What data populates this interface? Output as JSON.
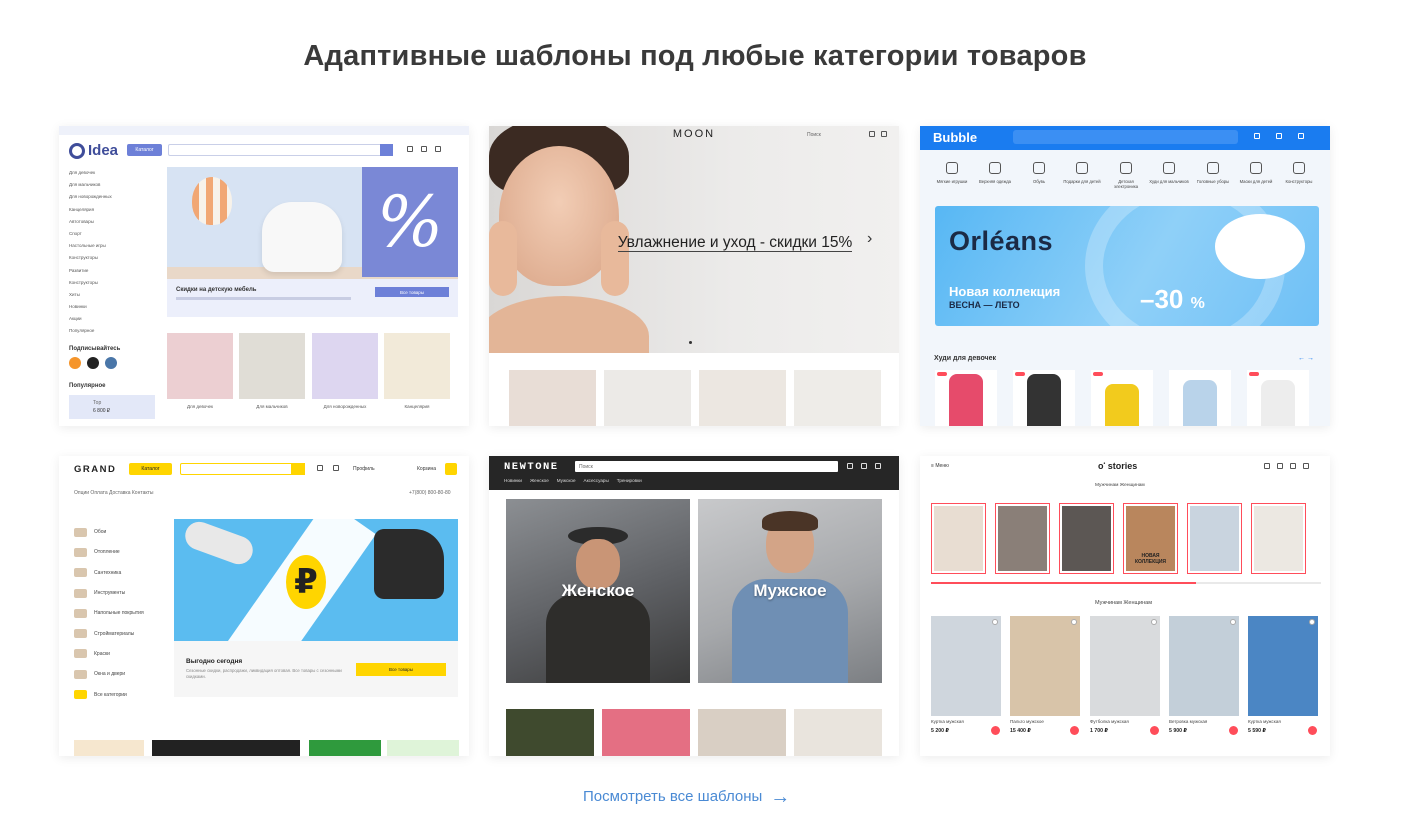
{
  "heading": "Адаптивные шаблоны под любые категории товаров",
  "footer": {
    "view_all": "Посмотреть все шаблоны",
    "arrow_icon": "arrow-right-icon"
  },
  "colors": {
    "link": "#4a8ad4",
    "idea": "#6d80d8",
    "bubble": "#1a7cf0",
    "grand": "#ffd500",
    "stories": "#ff4d5a"
  },
  "templates": {
    "idea": {
      "logo": "Idea",
      "catalog": "Каталог",
      "menu": [
        "Для девочек",
        "Для мальчиков",
        "Для новорожденных",
        "Канцелярия",
        "Автотовары",
        "Спорт",
        "Настольные игры",
        "Конструкторы",
        "Развитие",
        "Конструкторы",
        "Хиты",
        "Новинки",
        "Акции",
        "Популярное"
      ],
      "banner_title": "Скидки на детскую мебель",
      "banner_button": "Все товары",
      "subscribe": "Подписывайтесь",
      "popular": "Популярное",
      "popular_item_name": "Тор",
      "popular_item_price": "6 800 ₽",
      "products": [
        "Для девочек",
        "Для мальчиков",
        "Для новорожденных",
        "Канцелярия"
      ]
    },
    "moon": {
      "logo": "MOON",
      "search": "Поиск",
      "slide_text": "Увлажнение и уход - скидки 15%"
    },
    "bubble": {
      "logo": "Bubble",
      "categories": [
        "Мягкие игрушки",
        "Верхняя одежда",
        "Обувь",
        "Подарки для детей",
        "Детская электроника",
        "Худи для мальчиков",
        "Головные уборы",
        "Маски для детей",
        "Конструкторы"
      ],
      "banner_title": "Orléans",
      "banner_subtitle": "Новая коллекция",
      "banner_season": "ВЕСНА — ЛЕТО",
      "banner_sale": "–30",
      "banner_sale_pct": "%",
      "section": "Худи для девочек",
      "arrows": "← →"
    },
    "grand": {
      "logo": "GRAND",
      "catalog": "Каталог",
      "nav": "Опции  Оплата  Доставка  Контакты",
      "phone": "+7(800) 800-80-80",
      "profile": "Профиль",
      "cart": "Корзина",
      "side": [
        "Обои",
        "Отопление",
        "Сантехника",
        "Инструменты",
        "Напольные покрытия",
        "Стройматериалы",
        "Краски",
        "Окна и двери",
        "Все категории"
      ],
      "banner_title": "Выгодно сегодня",
      "banner_text": "Сезонные скидки, распродажи, ликвидация оптовая. Все товары с сезонными скидками.",
      "banner_button": "Все товары",
      "ruble": "₽"
    },
    "newtone": {
      "logo": "NEWTONE",
      "search": "Поиск",
      "menu": [
        "Новинки",
        "Женское",
        "Мужское",
        "Аксессуары",
        "Тренировки"
      ],
      "women": "Женское",
      "men": "Мужское"
    },
    "stories": {
      "menu": "Меню",
      "logo": "stories",
      "tabs": "Мужчинам   Женщинам",
      "story_caption": "НОВАЯ КОЛЛЕКЦИЯ",
      "sub_tabs": "Мужчинам  Женщинам",
      "products": [
        {
          "name": "Куртка мужская",
          "price": "5 200 ₽"
        },
        {
          "name": "Пальто мужское",
          "price": "15 400 ₽"
        },
        {
          "name": "Футболка мужская",
          "price": "1 700 ₽"
        },
        {
          "name": "Ветровка мужская",
          "price": "5 900 ₽"
        },
        {
          "name": "Куртка мужская",
          "price": "5 590 ₽"
        }
      ]
    }
  }
}
